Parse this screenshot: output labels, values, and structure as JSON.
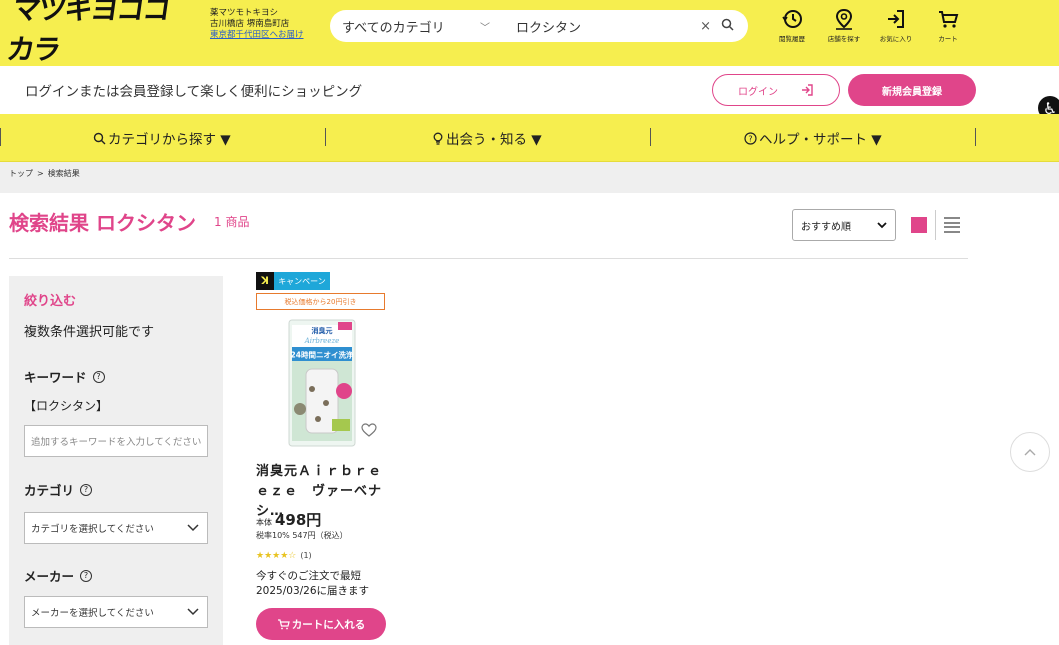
{
  "header": {
    "logo": "マツキヨココカラ",
    "store_line1": "薬マツモトキヨシ",
    "store_line2": "古川橋店 堺南島町店",
    "store_link": "東京都千代田区へお届け",
    "search": {
      "category": "すべてのカテゴリ",
      "query": "ロクシタン",
      "clear_icon": "×"
    },
    "icons": [
      {
        "label": "閲覧履歴",
        "icon": "history-icon"
      },
      {
        "label": "店舗を探す",
        "icon": "store-pin-icon"
      },
      {
        "label": "お気に入り",
        "icon": "favorite-login-icon"
      },
      {
        "label": "カート",
        "icon": "cart-icon"
      }
    ]
  },
  "loginbar": {
    "message": "ログインまたは会員登録して楽しく便利にショッピング",
    "login_label": "ログイン",
    "register_label": "新規会員登録"
  },
  "nav": {
    "items": [
      {
        "label": "カテゴリから探す ▼"
      },
      {
        "label": "出会う・知る ▼"
      },
      {
        "label": "ヘルプ・サポート ▼"
      }
    ]
  },
  "breadcrumb": {
    "top": "トップ",
    "sep": ">",
    "current": "検索結果"
  },
  "results": {
    "title": "検索結果 ロクシタン",
    "count": "1 商品",
    "sort": "おすすめ順"
  },
  "sidebar": {
    "title": "絞り込む",
    "note": "複数条件選択可能です",
    "keyword_heading": "キーワード",
    "keyword_value": "【ロクシタン】",
    "keyword_placeholder": "追加するキーワードを入力してください",
    "category_heading": "カテゴリ",
    "category_select": "カテゴリを選択してください",
    "maker_heading": "メーカー",
    "maker_select": "メーカーを選択してください"
  },
  "product": {
    "badge_logo": "ꓘ",
    "badge_campaign": "キャンペーン",
    "coupon": "税込価格から20円引き",
    "package_brand": "消臭元",
    "package_sub": "Airbreeze",
    "package_text": "24時間ニオイ洗浄",
    "name": "消臭元Ａｉｒｂｒｅｅｚｅ　ヴァーベナシ…",
    "price_prefix": "本体",
    "price": "498円",
    "tax": "税率10% 547円（税込）",
    "rating": "★★★★☆",
    "rating_count": "(1)",
    "rating_value": 4,
    "delivery": "今すぐのご注文で最短2025/03/26に届きます",
    "cart_label": "カートに入れる"
  },
  "colors": {
    "brand_yellow": "#f6ee4f",
    "accent_pink": "#e0458a",
    "campaign_blue": "#1ea7d9",
    "coupon_orange": "#e77a2d"
  }
}
